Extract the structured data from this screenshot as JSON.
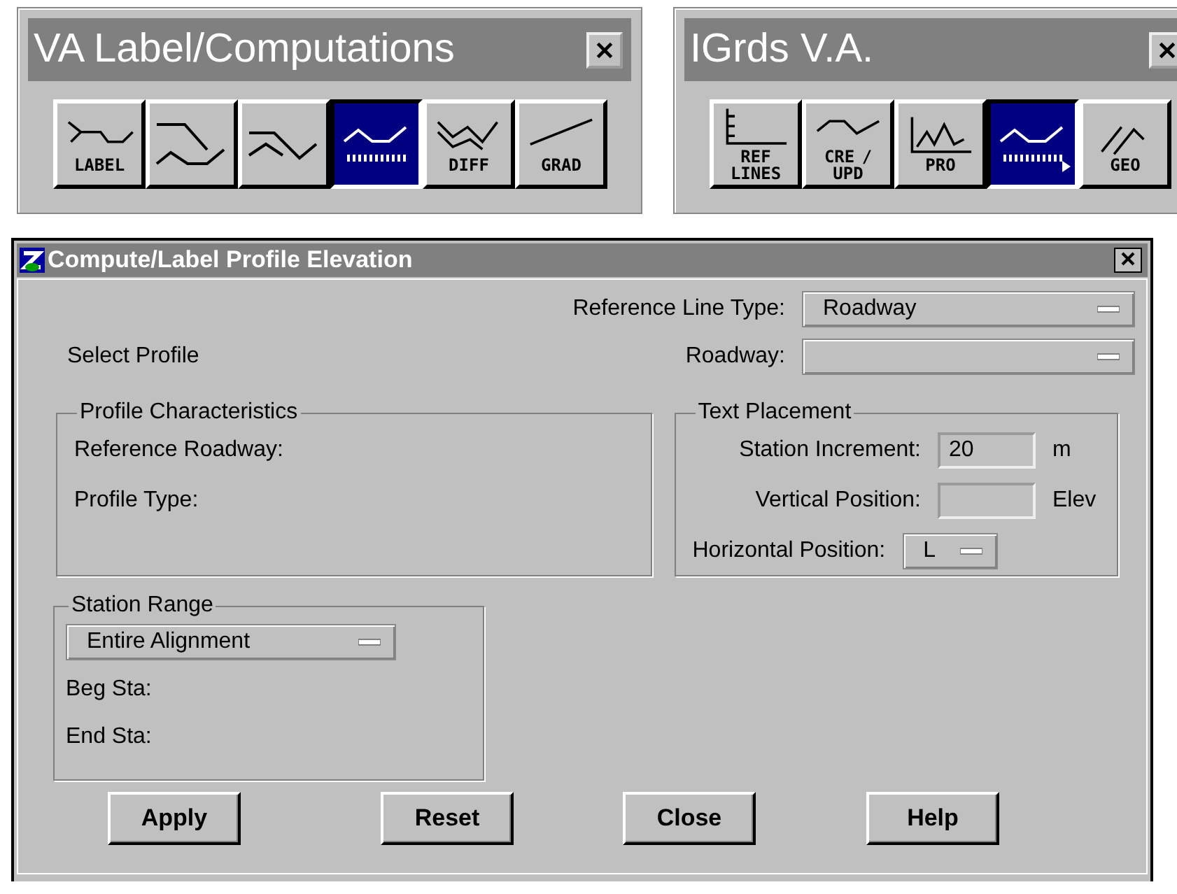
{
  "palettes": [
    {
      "title": "VA Label/Computations",
      "tools": [
        {
          "label": "LABEL",
          "selected": false
        },
        {
          "selected": false
        },
        {
          "selected": false
        },
        {
          "selected": true
        },
        {
          "label": "DIFF",
          "selected": false
        },
        {
          "label": "GRAD",
          "selected": false
        }
      ]
    },
    {
      "title": "IGrds V.A.",
      "tools": [
        {
          "label": "REF LINES",
          "selected": false
        },
        {
          "label": "CRE / UPD",
          "selected": false
        },
        {
          "label": "PRO",
          "selected": false
        },
        {
          "selected": true
        },
        {
          "label": "GEO",
          "selected": false
        }
      ]
    }
  ],
  "dialog": {
    "title": "Compute/Label Profile Elevation",
    "reference_line_type": {
      "label": "Reference Line Type:",
      "value": "Roadway"
    },
    "select_profile": "Select Profile",
    "roadway": {
      "label": "Roadway:"
    },
    "profile_characteristics": {
      "title": "Profile Characteristics",
      "rows": [
        "Reference Roadway:",
        "Profile Type:"
      ]
    },
    "text_placement": {
      "title": "Text Placement",
      "station_increment": {
        "label": "Station Increment:",
        "value": "20",
        "unit": "m"
      },
      "vertical_position": {
        "label": "Vertical Position:",
        "unit": "Elev"
      },
      "horizontal_position": {
        "label": "Horizontal Position:",
        "value": "L"
      }
    },
    "station_range": {
      "title": "Station Range",
      "mode": "Entire Alignment",
      "rows": [
        "Beg Sta:",
        "End Sta:"
      ]
    },
    "buttons": [
      "Apply",
      "Reset",
      "Close",
      "Help"
    ]
  }
}
